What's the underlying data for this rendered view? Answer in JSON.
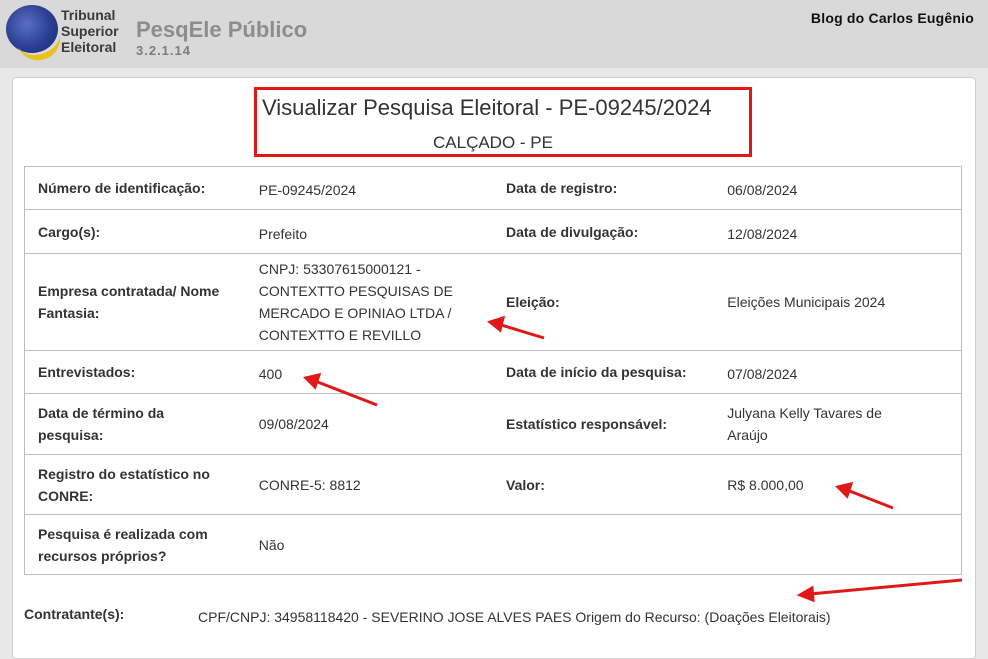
{
  "header": {
    "org_name_lines": [
      "Tribunal",
      "Superior",
      "Eleitoral"
    ],
    "app_title": "PesqEle Público",
    "app_version": "3.2.1.14",
    "watermark": "Blog do Carlos Eugênio"
  },
  "page": {
    "title": "Visualizar Pesquisa Eleitoral - PE-09245/2024",
    "subtitle": "CALÇADO - PE"
  },
  "details": {
    "rows": [
      {
        "label1": "Número de identificação:",
        "value1": "PE-09245/2024",
        "label2": "Data de registro:",
        "value2": "06/08/2024"
      },
      {
        "label1": "Cargo(s):",
        "value1": "Prefeito",
        "label2": "Data de divulgação:",
        "value2": "12/08/2024"
      },
      {
        "label1": "Empresa contratada/ Nome Fantasia:",
        "value1": "CNPJ: 53307615000121 - CONTEXTTO PESQUISAS DE MERCADO E OPINIAO LTDA / CONTEXTTO E REVILLO",
        "label2": "Eleição:",
        "value2": "Eleições Municipais 2024"
      },
      {
        "label1": "Entrevistados:",
        "value1": "400",
        "label2": "Data de início da pesquisa:",
        "value2": "07/08/2024"
      },
      {
        "label1": "Data de término da pesquisa:",
        "value1": "09/08/2024",
        "label2": "Estatístico responsável:",
        "value2": "Julyana Kelly Tavares de Araújo"
      },
      {
        "label1": "Registro do estatístico no CONRE:",
        "value1": "CONRE-5: 8812",
        "label2": "Valor:",
        "value2": "R$ 8.000,00"
      },
      {
        "label1": "Pesquisa é realizada com recursos próprios?",
        "value1": "Não",
        "label2": "",
        "value2": ""
      }
    ]
  },
  "contratante": {
    "label": "Contratante(s):",
    "value": "CPF/CNPJ: 34958118420 - SEVERINO JOSE ALVES PAES Origem do Recurso: (Doações Eleitorais)"
  },
  "colors": {
    "annotation": "#e01818",
    "header_bg": "#d9d9d9",
    "logo_blue": "#2a3f93",
    "logo_gold": "#e8c21b"
  }
}
